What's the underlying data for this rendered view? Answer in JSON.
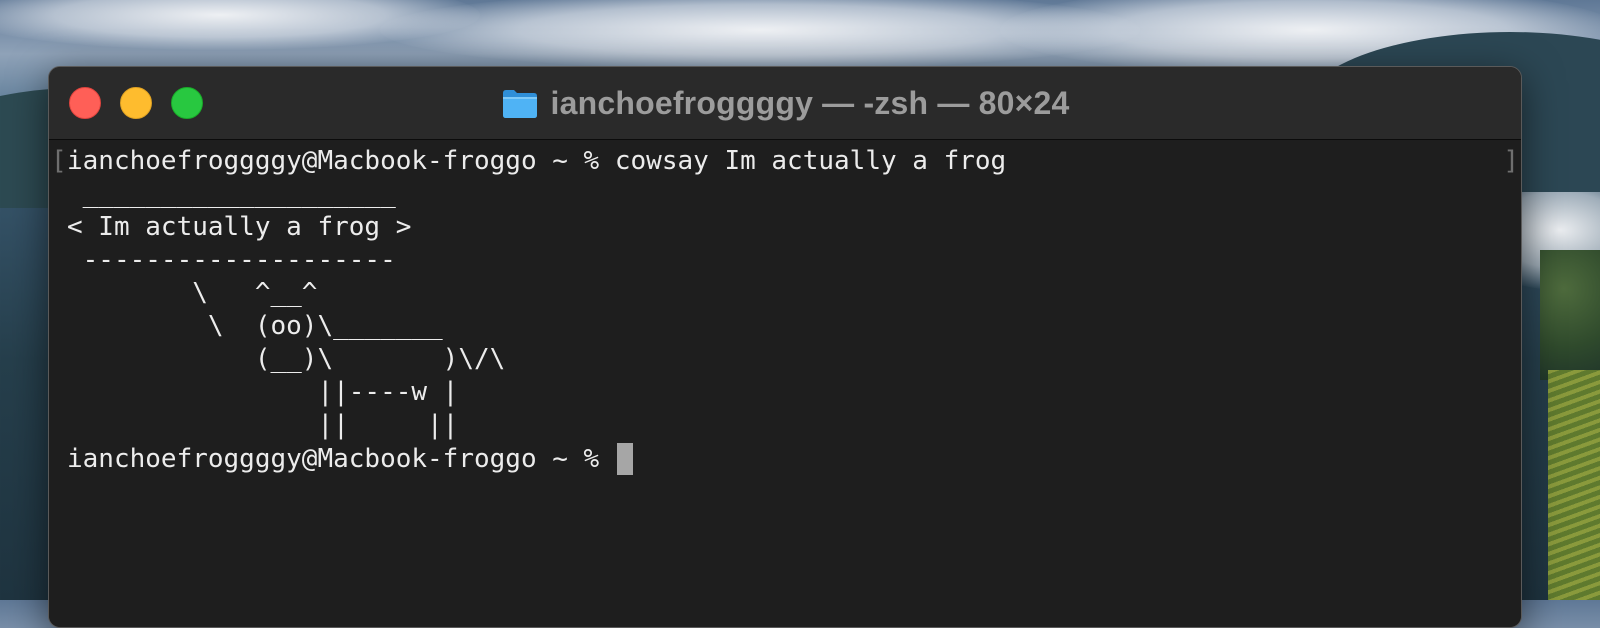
{
  "window": {
    "title": "ianchoefroggggy — -zsh — 80×24",
    "title_icon": "folder-icon",
    "traffic_lights": {
      "close": "#ff5f57",
      "minimize": "#febc2e",
      "maximize": "#28c840"
    }
  },
  "terminal": {
    "command_line": "ianchoefroggggy@Macbook-froggo ~ % cowsay Im actually a frog",
    "output": [
      " ____________________ ",
      "< Im actually a frog >",
      " -------------------- ",
      "        \\   ^__^",
      "         \\  (oo)\\_______",
      "            (__)\\       )\\/\\",
      "                ||----w |",
      "                ||     ||"
    ],
    "prompt": "ianchoefroggggy@Macbook-froggo ~ % ",
    "bracket_left": "[",
    "bracket_right": "]"
  }
}
